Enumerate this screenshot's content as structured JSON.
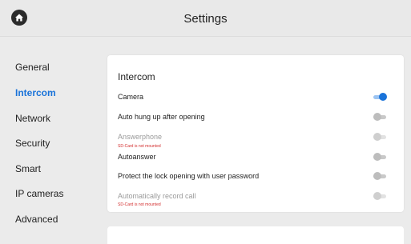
{
  "header": {
    "title": "Settings",
    "home_icon": "home-icon"
  },
  "sidebar": {
    "items": [
      {
        "label": "General",
        "active": false
      },
      {
        "label": "Intercom",
        "active": true
      },
      {
        "label": "Network",
        "active": false
      },
      {
        "label": "Security",
        "active": false
      },
      {
        "label": "Smart",
        "active": false
      },
      {
        "label": "IP cameras",
        "active": false
      },
      {
        "label": "Advanced",
        "active": false
      }
    ]
  },
  "intercom": {
    "title": "Intercom",
    "rows": [
      {
        "label": "Camera",
        "enabled": true,
        "on": true
      },
      {
        "label": "Auto hung up after opening",
        "enabled": true,
        "on": false
      },
      {
        "label": "Answerphone",
        "enabled": false,
        "on": false,
        "note": "SD-Card is not mounted"
      },
      {
        "label": "Autoanswer",
        "enabled": true,
        "on": false
      },
      {
        "label": "Protect the lock opening with user password",
        "enabled": true,
        "on": false
      },
      {
        "label": "Automatically record call",
        "enabled": false,
        "on": false,
        "note": "SD-Card is not mounted"
      }
    ]
  },
  "colors": {
    "accent": "#1a73d9",
    "warning": "#d32f2f",
    "background": "#ebebeb"
  }
}
